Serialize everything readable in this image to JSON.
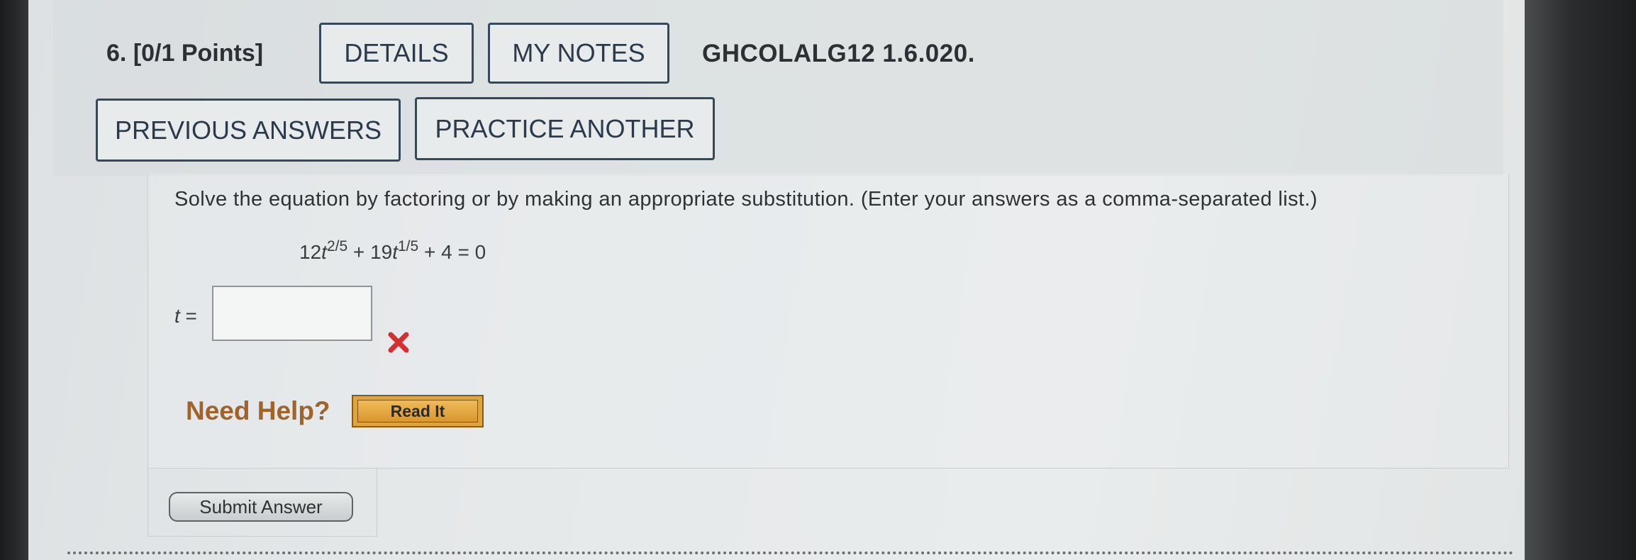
{
  "question": {
    "number_label": "6.",
    "points_label": "[0/1 Points]",
    "course_code": "GHCOLALG12 1.6.020."
  },
  "header_buttons": {
    "details": "DETAILS",
    "my_notes": "MY NOTES",
    "previous_answers": "PREVIOUS ANSWERS",
    "practice_another": "PRACTICE ANOTHER"
  },
  "prompt": "Solve the equation by factoring or by making an appropriate substitution. (Enter your answers as a comma-separated list.)",
  "equation": {
    "coef1": "12",
    "var": "t",
    "exp1": "2/5",
    "op1": " + ",
    "coef2": "19",
    "exp2": "1/5",
    "tail": " + 4 = 0"
  },
  "answer": {
    "label_var": "t",
    "label_eq": " =",
    "value": "",
    "status": "incorrect",
    "status_icon": "red-x-icon",
    "status_color": "#d62f2f"
  },
  "help": {
    "need_help": "Need Help?",
    "read_it": "Read It",
    "read_it_color": "#e0a43e"
  },
  "submit_label": "Submit Answer"
}
